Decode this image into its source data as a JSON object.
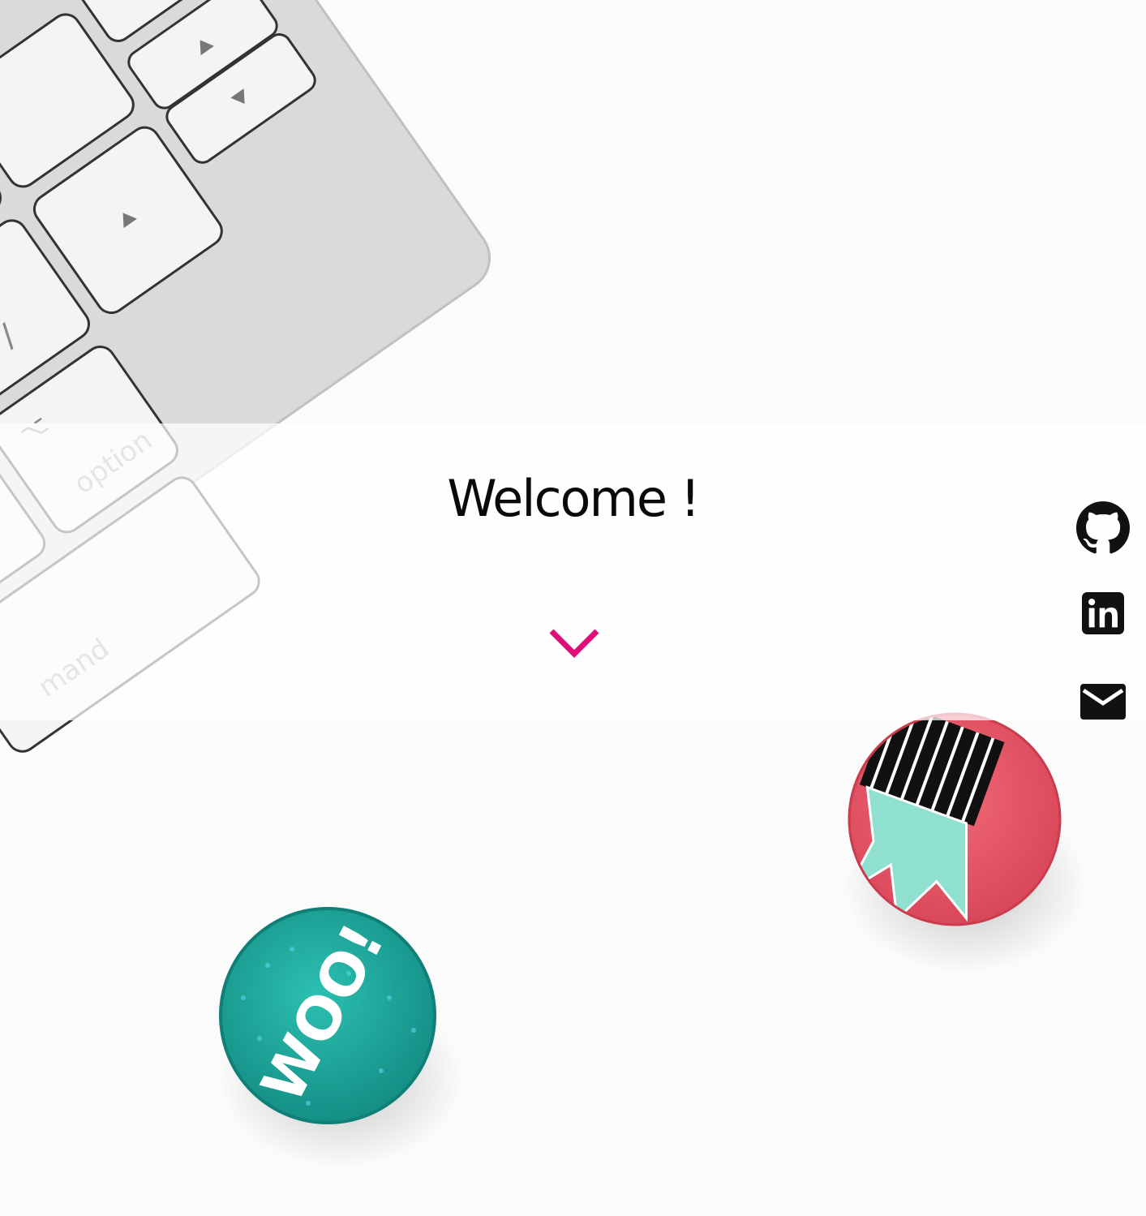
{
  "hero": {
    "title": "Welcome !",
    "scroll_icon": "chevron-down-icon",
    "accent_color": "#e0107a",
    "background_image": {
      "keyboard_keys": [
        "?",
        "/",
        "option",
        "⌥",
        "mand"
      ],
      "button_left_text": "WOO!",
      "button_left_color": "#1aa79a",
      "button_right_color": "#ec5668"
    }
  },
  "social": {
    "links": [
      {
        "icon": "github-icon"
      },
      {
        "icon": "linkedin-icon"
      },
      {
        "icon": "mail-icon"
      }
    ]
  }
}
